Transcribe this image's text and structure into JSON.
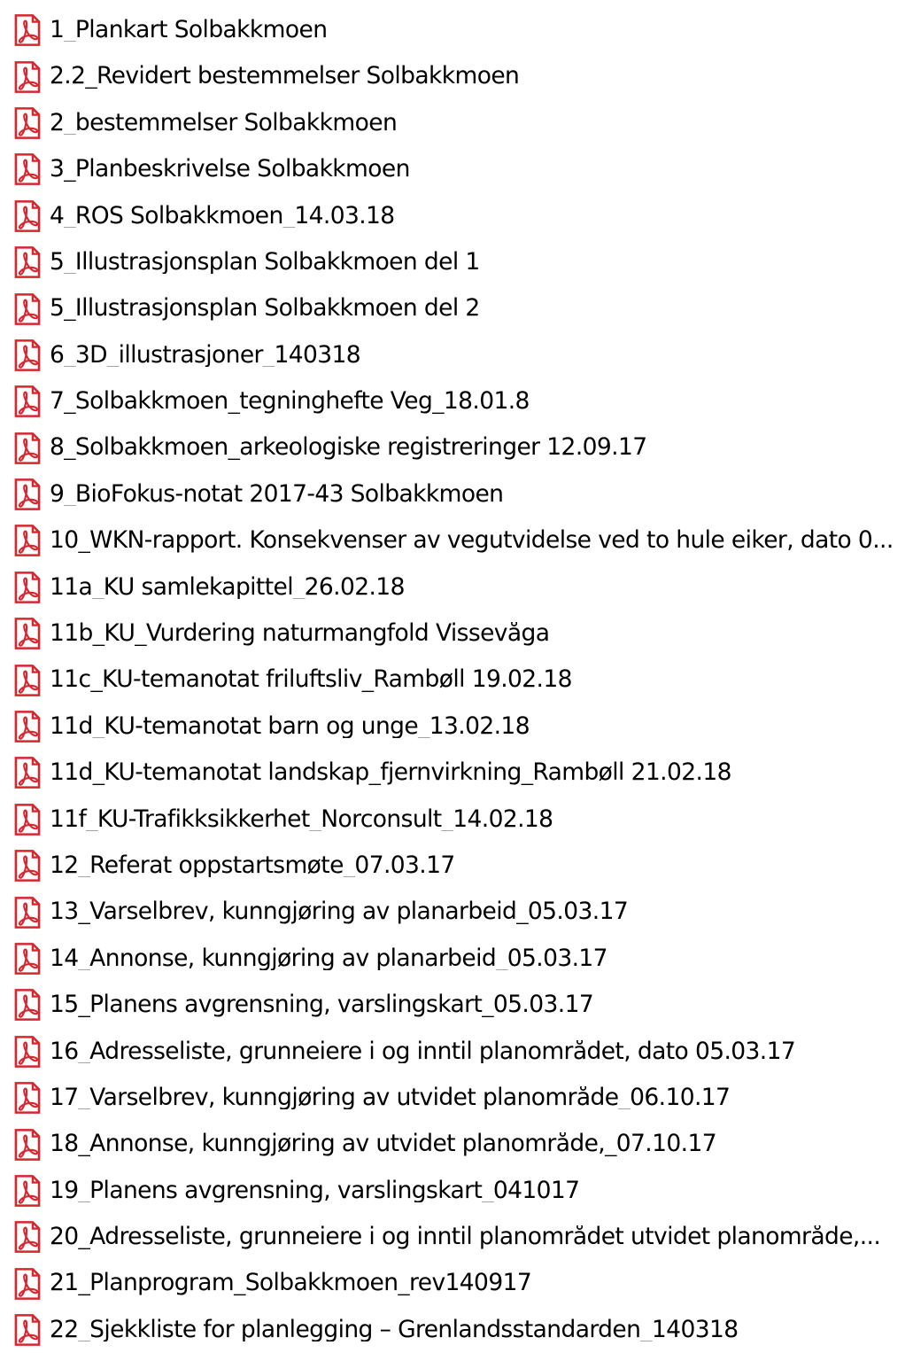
{
  "colors": {
    "icon_red": "#d8262f",
    "icon_paper": "#ffffff",
    "text": "#000000"
  },
  "files": [
    {
      "name": "1_Plankart Solbakkmoen",
      "icon": "pdf-file-icon"
    },
    {
      "name": "2.2_Revidert bestemmelser Solbakkmoen",
      "icon": "pdf-file-icon"
    },
    {
      "name": "2_bestemmelser Solbakkmoen",
      "icon": "pdf-file-icon"
    },
    {
      "name": "3_Planbeskrivelse Solbakkmoen",
      "icon": "pdf-file-icon"
    },
    {
      "name": "4_ROS Solbakkmoen_14.03.18",
      "icon": "pdf-file-icon"
    },
    {
      "name": "5_Illustrasjonsplan Solbakkmoen del 1",
      "icon": "pdf-file-icon"
    },
    {
      "name": "5_Illustrasjonsplan Solbakkmoen del 2",
      "icon": "pdf-file-icon"
    },
    {
      "name": "6_3D_illustrasjoner_140318",
      "icon": "pdf-file-icon"
    },
    {
      "name": "7_Solbakkmoen_tegninghefte Veg_18.01.8",
      "icon": "pdf-file-icon"
    },
    {
      "name": "8_Solbakkmoen_arkeologiske registreringer 12.09.17",
      "icon": "pdf-file-icon"
    },
    {
      "name": "9_BioFokus-notat 2017-43 Solbakkmoen",
      "icon": "pdf-file-icon"
    },
    {
      "name": "10_WKN-rapport. Konsekvenser av vegutvidelse ved to hule eiker, dato 0...",
      "icon": "pdf-file-icon"
    },
    {
      "name": "11a_KU samlekapittel_26.02.18",
      "icon": "pdf-file-icon"
    },
    {
      "name": "11b_KU_Vurdering naturmangfold Vissevåga",
      "icon": "pdf-file-icon"
    },
    {
      "name": "11c_KU-temanotat friluftsliv_Rambøll 19.02.18",
      "icon": "pdf-file-icon"
    },
    {
      "name": "11d_KU-temanotat barn og unge_13.02.18",
      "icon": "pdf-file-icon"
    },
    {
      "name": "11d_KU-temanotat landskap_fjernvirkning_Rambøll 21.02.18",
      "icon": "pdf-file-icon"
    },
    {
      "name": "11f_KU-Trafikksikkerhet_Norconsult_14.02.18",
      "icon": "pdf-file-icon"
    },
    {
      "name": "12_Referat oppstartsmøte_07.03.17",
      "icon": "pdf-file-icon"
    },
    {
      "name": "13_Varselbrev, kunngjøring av planarbeid_05.03.17",
      "icon": "pdf-file-icon"
    },
    {
      "name": "14_Annonse, kunngjøring av planarbeid_05.03.17",
      "icon": "pdf-file-icon"
    },
    {
      "name": "15_Planens avgrensning, varslingskart_05.03.17",
      "icon": "pdf-file-icon"
    },
    {
      "name": "16_Adresseliste, grunneiere i og inntil planområdet, dato 05.03.17",
      "icon": "pdf-file-icon"
    },
    {
      "name": "17_Varselbrev, kunngjøring av utvidet planområde_06.10.17",
      "icon": "pdf-file-icon"
    },
    {
      "name": "18_Annonse, kunngjøring av utvidet planområde,_07.10.17",
      "icon": "pdf-file-icon"
    },
    {
      "name": "19_Planens avgrensning, varslingskart_041017",
      "icon": "pdf-file-icon"
    },
    {
      "name": "20_Adresseliste, grunneiere i og inntil planområdet utvidet planområde,...",
      "icon": "pdf-file-icon"
    },
    {
      "name": "21_Planprogram_Solbakkmoen_rev140917",
      "icon": "pdf-file-icon"
    },
    {
      "name": "22_Sjekkliste for planlegging – Grenlandsstandarden_140318",
      "icon": "pdf-file-icon"
    }
  ]
}
